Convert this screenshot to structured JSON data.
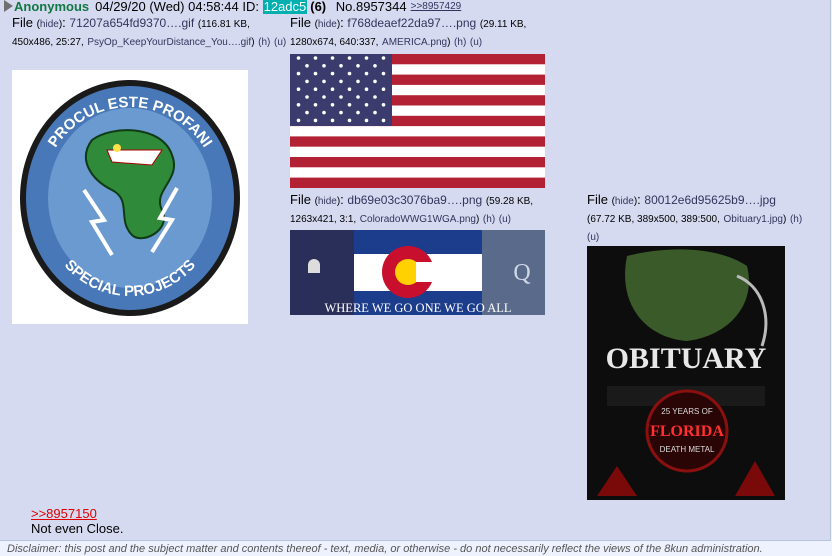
{
  "post": {
    "name": "Anonymous",
    "date": "04/29/20 (Wed) 04:58:44",
    "id_label": "ID:",
    "id": "12adc5",
    "id_count": "(6)",
    "no": "No.8957344",
    "backlink": ">>8957429"
  },
  "files": [
    {
      "label": "File",
      "hide": "hide",
      "name": "71207a654fd9370….gif",
      "meta": "(116.81 KB, 450x486, 25:27,",
      "orig": "PsyOp_KeepYourDistance_You….gif",
      "h": "(h)",
      "u": "(u)",
      "image_name": "special-projects-patch",
      "image_text": [
        "PROCUL ESTE PROFANI",
        "SPECIAL PROJECTS"
      ]
    },
    {
      "label": "File",
      "hide": "hide",
      "name": "f768deaef22da97….png",
      "meta": "(29.11 KB,",
      "meta2": "1280x674, 640:337,",
      "orig": "AMERICA.png",
      "h": "(h)",
      "u": "(u)",
      "image_name": "american-flag"
    },
    {
      "label": "File",
      "hide": "hide",
      "name": "db69e03c3076ba9….png",
      "meta": "(59.28 KB,",
      "meta2": "1263x421, 3:1,",
      "orig": "ColoradoWWG1WGA.png",
      "h": "(h)",
      "u": "(u)",
      "image_name": "colorado-wwg1wga-banner",
      "image_text": "WHERE WE GO ONE WE GO ALL"
    },
    {
      "label": "File",
      "hide": "hide",
      "name": "80012e6d95625b9….jpg",
      "meta": "(67.72 KB, 389x500, 389:500,",
      "orig": "Obituary1.jpg",
      "h": "(h)",
      "u": "(u)",
      "image_name": "obituary-poster",
      "image_text": [
        "OBITUARY",
        "25 YEARS OF",
        "FLORIDA",
        "DEATH METAL"
      ]
    }
  ],
  "body": {
    "quote": ">>8957150",
    "text": "Not even Close."
  },
  "disclaimer": "Disclaimer: this post and the subject matter and contents thereof - text, media, or otherwise - do not necessarily reflect the views of the 8kun administration.",
  "colors": {
    "name": "#117743",
    "id_bg": "#00b0b0",
    "quote": "#dd0000",
    "link": "#34345c",
    "post_bg": "#d6daf0"
  }
}
